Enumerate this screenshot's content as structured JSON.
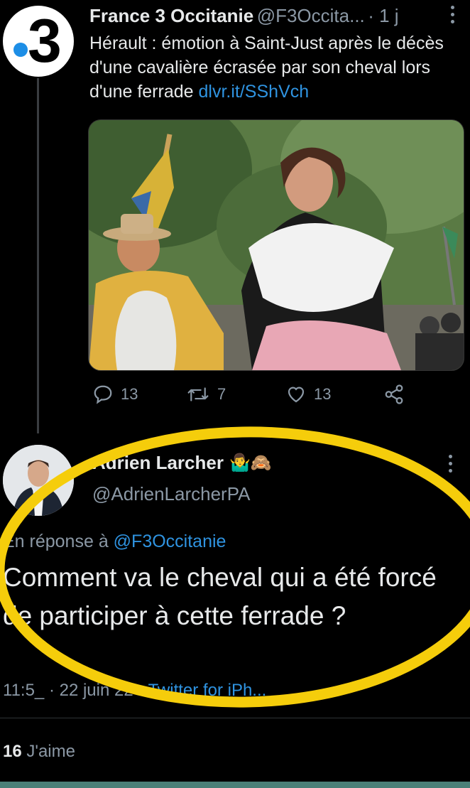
{
  "tweet1": {
    "avatar_text": "3",
    "name": "France 3 Occitanie",
    "handle": "@F3Occita...",
    "time": "· 1 j",
    "text": "Hérault : émotion à Saint-Just après le décès d'une cavalière écrasée par son cheval lors d'une ferrade",
    "link": "dlvr.it/SShVch",
    "replies": "13",
    "retweets": "7",
    "likes": "13"
  },
  "tweet2": {
    "name": "Adrien Larcher",
    "emoji": "🤷‍♂️🙈",
    "handle": "@AdrienLarcherPA",
    "reply_prefix": "En réponse à",
    "reply_to": "@F3Occitanie",
    "text": "Comment va le cheval qui a été forcé de participer à cette ferrade ?",
    "meta_time": "11:5_ · 22 juin 22 ·",
    "meta_source": "Twitter for iPh...",
    "like_count": "16",
    "like_label": "J'aime"
  },
  "colors": {
    "background": "#000000",
    "link": "#2f93e0",
    "secondary_text": "#8b98a5",
    "highlight": "#f5cd0b"
  }
}
